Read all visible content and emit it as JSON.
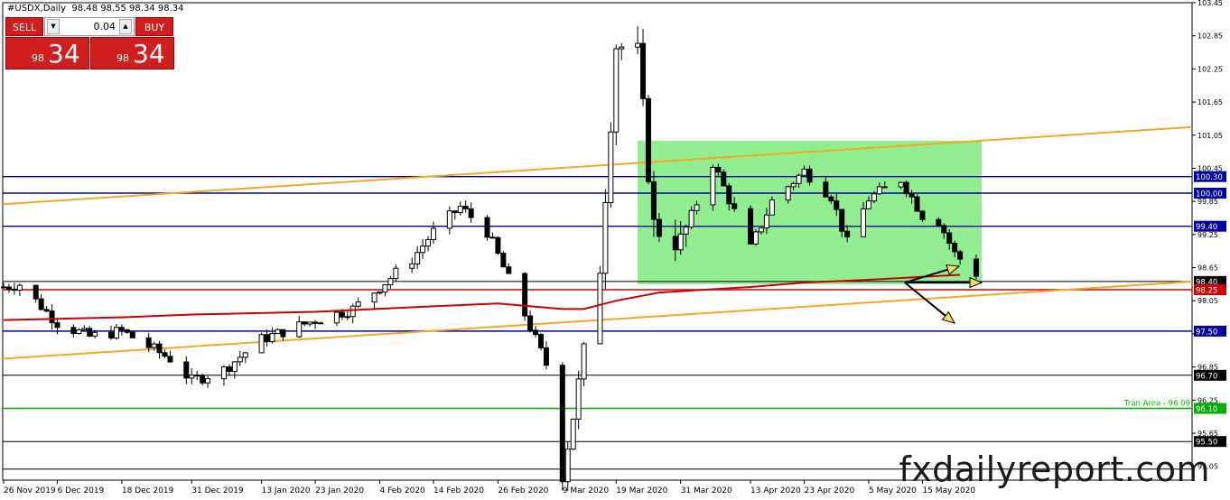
{
  "header": {
    "title": "#USDX,Daily  98.48 98.55 98.34 98.34"
  },
  "trade_panel": {
    "sell_label": "SELL",
    "buy_label": "BUY",
    "lot_value": "0.04",
    "sell_price_small": "98",
    "sell_price_big": "34",
    "buy_price_small": "98",
    "buy_price_big": "34"
  },
  "brand": "fxdailyreport.com",
  "chart_data": {
    "type": "candlestick",
    "symbol": "#USDX",
    "timeframe": "Daily",
    "ohlc": {
      "open": 98.48,
      "high": 98.55,
      "low": 98.34,
      "close": 98.34
    },
    "ylim": [
      94.8,
      103.45
    ],
    "y_ticks": [
      "103.45",
      "102.85",
      "102.25",
      "101.65",
      "101.05",
      "100.45",
      "99.85",
      "99.25",
      "98.65",
      "98.05",
      "97.45",
      "96.85",
      "96.25",
      "95.65",
      "95.05"
    ],
    "x_ticks": [
      "26 Nov 2019",
      "6 Dec 2019",
      "18 Dec 2019",
      "31 Dec 2019",
      "13 Jan 2020",
      "23 Jan 2020",
      "4 Feb 2020",
      "14 Feb 2020",
      "26 Feb 2020",
      "9 Mar 2020",
      "19 Mar 2020",
      "31 Mar 2020",
      "13 Apr 2020",
      "23 Apr 2020",
      "5 May 2020",
      "15 May 2020"
    ],
    "levels": [
      {
        "price": "100.30",
        "color": "#0000a0",
        "badge": "100.30"
      },
      {
        "price": "100.00",
        "color": "#0000a0",
        "badge": "100.00"
      },
      {
        "price": "99.40",
        "color": "#0000a0",
        "badge": "99.40"
      },
      {
        "price": "98.40",
        "color": "#000000",
        "badge": "98.40"
      },
      {
        "price": "98.25",
        "color": "#d00000",
        "badge": "98.25"
      },
      {
        "price": "97.50",
        "color": "#0000a0",
        "badge": "97.50"
      },
      {
        "price": "96.70",
        "color": "#000000",
        "badge": "96.70"
      },
      {
        "price": "96.10",
        "color": "#00b000",
        "badge": "96.10"
      },
      {
        "price": "95.50",
        "color": "#000000",
        "badge": "95.50"
      },
      {
        "price": "95.00",
        "color": "#000000",
        "badge": ""
      }
    ],
    "range_box": {
      "start": "23 Mar 2020",
      "end": "26 May 2020",
      "top": 100.95,
      "bottom": 98.35,
      "color": "#90ee90"
    },
    "trendlines": [
      {
        "name": "upper channel",
        "color": "#f5a623",
        "from": [
          "26 Nov 2019",
          99.8
        ],
        "to": [
          "26 May 2020",
          100.95
        ]
      },
      {
        "name": "lower channel",
        "color": "#f5a623",
        "from": [
          "26 Nov 2019",
          97.0
        ],
        "to": [
          "26 May 2020",
          98.15
        ]
      }
    ],
    "moving_average": {
      "color": "#cc0000",
      "points": [
        [
          "26 Nov 2019",
          97.7
        ],
        [
          "18 Dec 2019",
          97.75
        ],
        [
          "31 Dec 2019",
          97.8
        ],
        [
          "23 Jan 2020",
          97.85
        ],
        [
          "14 Feb 2020",
          97.95
        ],
        [
          "26 Feb 2020",
          98.0
        ],
        [
          "9 Mar 2020",
          97.9
        ],
        [
          "13 Mar 2020",
          97.9
        ],
        [
          "19 Mar 2020",
          98.05
        ],
        [
          "27 Mar 2020",
          98.2
        ],
        [
          "13 Apr 2020",
          98.3
        ],
        [
          "23 Apr 2020",
          98.38
        ],
        [
          "5 May 2020",
          98.43
        ],
        [
          "18 May 2020",
          98.5
        ],
        [
          "22 May 2020",
          98.52
        ]
      ]
    },
    "green_label": "Tran Area - 96.09",
    "green_label_color": "#00c000",
    "arrows_color": "#f0e060"
  }
}
